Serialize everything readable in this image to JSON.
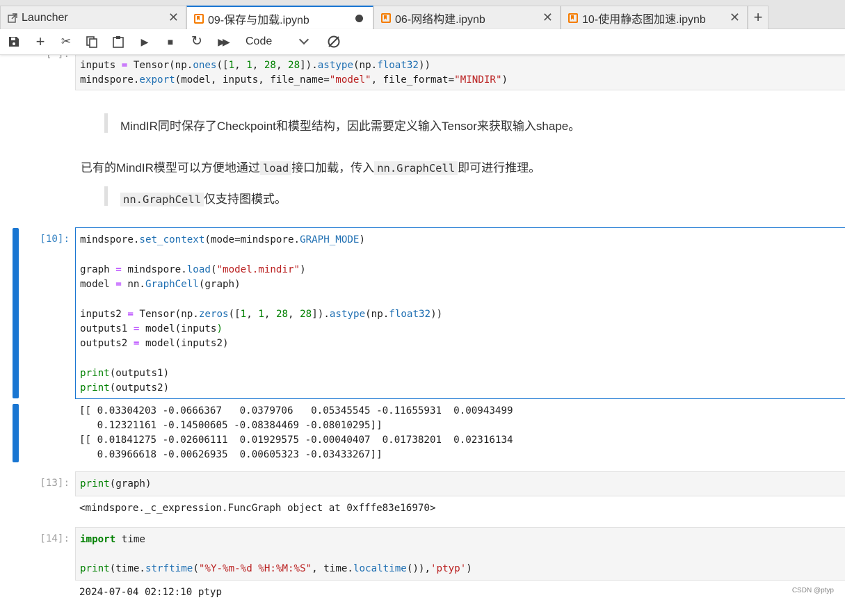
{
  "tabs": [
    {
      "label": "Launcher",
      "icon": "external-link-icon"
    },
    {
      "label": "09-保存与加载.ipynb",
      "icon": "notebook-icon"
    },
    {
      "label": "06-网络构建.ipynb",
      "icon": "notebook-icon"
    },
    {
      "label": "10-使用静态图加速.ipynb",
      "icon": "notebook-icon"
    }
  ],
  "toolbar": {
    "cell_type": "Code"
  },
  "top_cell": {
    "line1": [
      "inputs ",
      "= ",
      "Tensor(np.",
      "ones",
      "([",
      "1",
      ", ",
      "1",
      ", ",
      "28",
      ", ",
      "28",
      "]).",
      "astype",
      "(np.",
      "float32",
      "))"
    ],
    "line2": [
      "mindspore.",
      "export",
      "(model, inputs, file_name=",
      "\"model\"",
      ", file_format=",
      "\"MINDIR\"",
      ")"
    ]
  },
  "markdown": {
    "quote1": "MindIR同时保存了Checkpoint和模型结构，因此需要定义输入Tensor来获取输入shape。",
    "para_before": "已有的MindIR模型可以方便地通过",
    "para_code1": "load",
    "para_mid": "接口加载，传入",
    "para_code2": "nn.GraphCell",
    "para_after": "即可进行推理。",
    "quote2_code": "nn.GraphCell",
    "quote2_text": "仅支持图模式。"
  },
  "cell10": {
    "prompt": "[10]:",
    "lines": [
      "mindspore.set_context(mode=mindspore.GRAPH_MODE)",
      "",
      "graph = mindspore.load(\"model.mindir\")",
      "model = nn.GraphCell(graph)",
      "",
      "inputs2 = Tensor(np.zeros([1, 1, 28, 28]).astype(np.float32))",
      "outputs1 = model(inputs)",
      "outputs2 = model(inputs2)",
      "",
      "print(outputs1)",
      "print(outputs2)"
    ],
    "output": [
      "[[ 0.03304203 -0.0666367   0.0379706   0.05345545 -0.11655931  0.00943499",
      "   0.12321161 -0.14500605 -0.08384469 -0.08010295]]",
      "[[ 0.01841275 -0.02606111  0.01929575 -0.00040407  0.01738201  0.02316134",
      "   0.03966618 -0.00626935  0.00605323 -0.03433267]]"
    ]
  },
  "cell13": {
    "prompt": "[13]:",
    "code": "print(graph)",
    "output": "<mindspore._c_expression.FuncGraph object at 0xfffe83e16970>"
  },
  "cell14": {
    "prompt": "[14]:",
    "line1": "import time",
    "line2": "print(time.strftime(\"%Y-%m-%d %H:%M:%S\", time.localtime()),'ptyp')",
    "output": "2024-07-04 02:12:10 ptyp"
  },
  "watermark": "CSDN @ptyp"
}
